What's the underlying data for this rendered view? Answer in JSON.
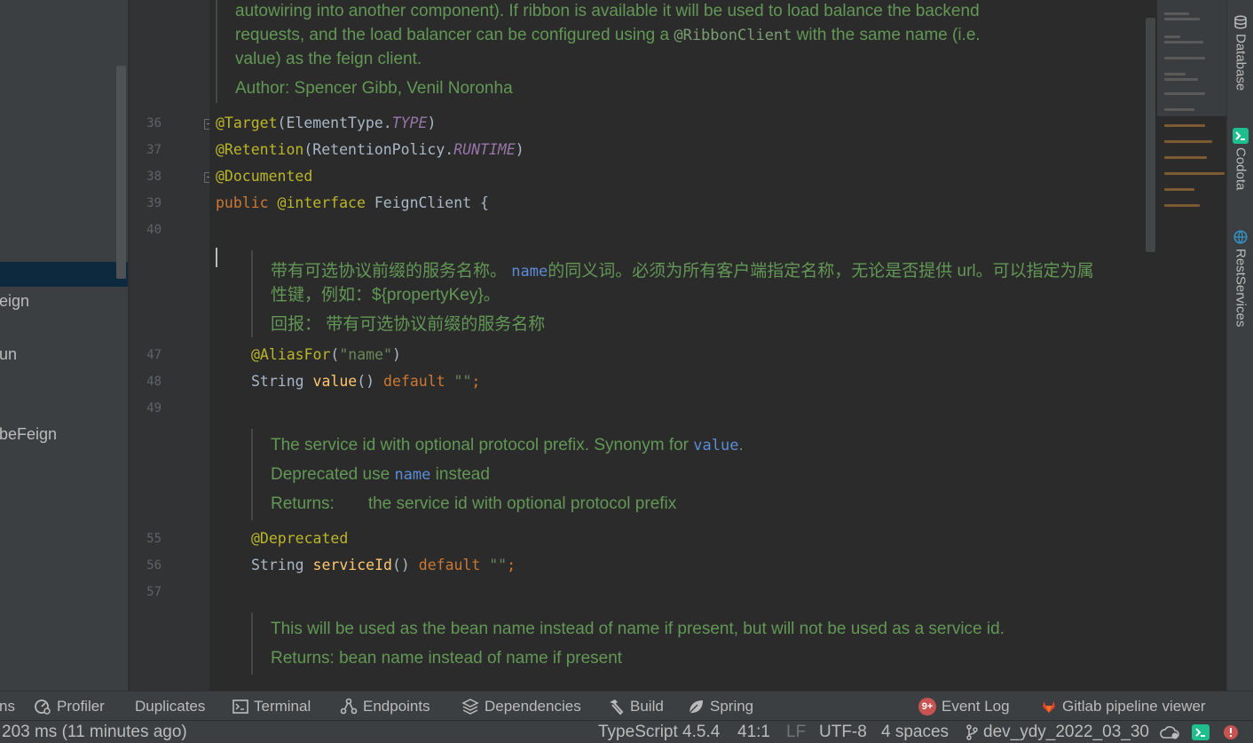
{
  "project_tree": {
    "items": [
      "eign",
      "un",
      "beFeign"
    ]
  },
  "gutter": {
    "line_numbers": [
      "36",
      "37",
      "38",
      "39",
      "40",
      "47",
      "48",
      "49",
      "55",
      "56",
      "57"
    ]
  },
  "editor": {
    "doc_top": {
      "line1": "autowiring into another component). If ribbon is available it will be used to load balance the backend",
      "line2_a": "requests, and the load balancer can be configured using a ",
      "line2_code": "@RibbonClient",
      "line2_b": " with the same name (i.e.",
      "line3": "value) as the feign client.",
      "author": "Author: Spencer Gibb, Venil Noronha"
    },
    "code_36": {
      "ann": "@Target",
      "a": "(ElementType.",
      "c": "TYPE",
      "b": ")"
    },
    "code_37": {
      "ann": "@Retention",
      "a": "(RetentionPolicy.",
      "c": "RUNTIME",
      "b": ")"
    },
    "code_38": {
      "ann": "@Documented"
    },
    "code_39": {
      "kw": "public",
      "ann": "@interface",
      "name": "FeignClient",
      "b": " {"
    },
    "doc_value": {
      "line1_a": "带有可选协议前缀的服务名称。 ",
      "line1_code": "name",
      "line1_b": "的同义词。必须为所有客户端指定名称，无论是否提供 url。可以指定为属",
      "line2": "性键，例如：${propertyKey}。",
      "returns": "回报：  带有可选协议前缀的服务名称"
    },
    "code_47": {
      "ann": "@AliasFor",
      "a": "(",
      "str": "\"name\"",
      "b": ")"
    },
    "code_48": {
      "type": "String",
      "fn": "value",
      "a": "() ",
      "kw": "default",
      "str": "\"\"",
      "b": ";"
    },
    "doc_serviceid": {
      "line1_a": "The service id with optional protocol prefix. Synonym for ",
      "line1_code": "value",
      "line1_b": ".",
      "dep_a": "Deprecated ",
      "dep_b": " use ",
      "dep_code": "name",
      "dep_c": " instead",
      "ret_label": "Returns:",
      "ret_text": "the service id with optional protocol prefix"
    },
    "code_55": {
      "ann": "@Deprecated"
    },
    "code_56": {
      "type": "String",
      "fn": "serviceId",
      "a": "() ",
      "kw": "default",
      "str": "\"\"",
      "b": ";"
    },
    "doc_contextid": {
      "line1": "This will be used as the bean name instead of name if present, but will not be used as a service id.",
      "returns": "Returns: bean name instead of name if present"
    }
  },
  "right_tools": {
    "database": "Database",
    "codota": "Codota",
    "restservices": "RestServices"
  },
  "tool_windows": {
    "cut_left": "ns",
    "profiler": "Profiler",
    "duplicates": "Duplicates",
    "terminal": "Terminal",
    "endpoints": "Endpoints",
    "dependencies": "Dependencies",
    "build": "Build",
    "spring": "Spring",
    "event_badge": "9+",
    "event_log": "Event Log",
    "gitlab": "Gitlab pipeline viewer"
  },
  "status_bar": {
    "message": "203 ms (11 minutes ago)",
    "language": "TypeScript 4.5.4",
    "position": "41:1",
    "line_sep": "LF",
    "encoding": "UTF-8",
    "indent": "4 spaces",
    "branch": "dev_ydy_2022_03_30"
  },
  "colors": {
    "editor_bg": "#2b2b2b",
    "panel_bg": "#3c3f41",
    "doc_green": "#629755",
    "annotation": "#bbb529",
    "keyword": "#cc7832",
    "accent_red": "#c75450"
  }
}
